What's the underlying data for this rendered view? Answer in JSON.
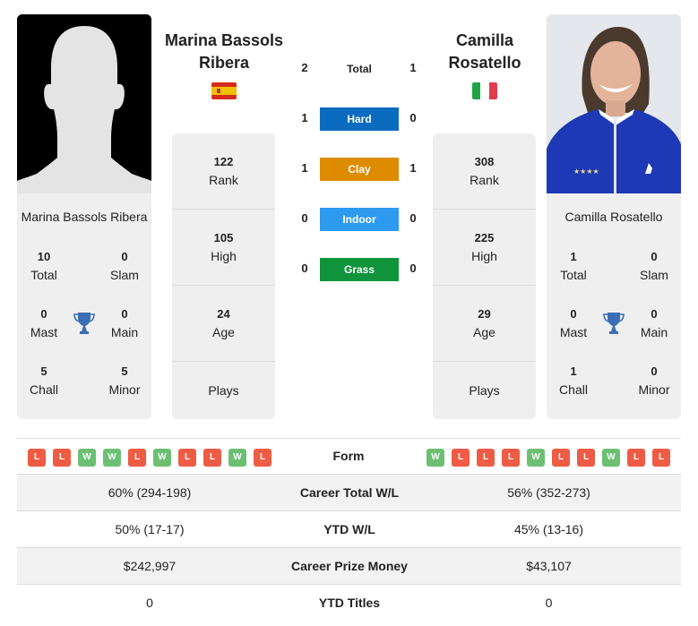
{
  "players": {
    "left": {
      "name": "Marina Bassols Ribera",
      "header_line1": "Marina Bassols",
      "header_line2": "Ribera",
      "flag": "spain-flag",
      "photo": "silhouette-placeholder",
      "rank": "122",
      "rank_label": "Rank",
      "high": "105",
      "high_label": "High",
      "age": "24",
      "age_label": "Age",
      "plays_label": "Plays",
      "titles": {
        "total": "10",
        "total_label": "Total",
        "slam": "0",
        "slam_label": "Slam",
        "mast": "0",
        "mast_label": "Mast",
        "main": "0",
        "main_label": "Main",
        "chall": "5",
        "chall_label": "Chall",
        "minor": "5",
        "minor_label": "Minor"
      },
      "form": [
        "L",
        "L",
        "W",
        "W",
        "L",
        "W",
        "L",
        "L",
        "W",
        "L"
      ]
    },
    "right": {
      "name": "Camilla Rosatello",
      "header_line1": "Camilla",
      "header_line2": "Rosatello",
      "flag": "italy-flag",
      "photo": "player-photo",
      "rank": "308",
      "rank_label": "Rank",
      "high": "225",
      "high_label": "High",
      "age": "29",
      "age_label": "Age",
      "plays_label": "Plays",
      "titles": {
        "total": "1",
        "total_label": "Total",
        "slam": "0",
        "slam_label": "Slam",
        "mast": "0",
        "mast_label": "Mast",
        "main": "0",
        "main_label": "Main",
        "chall": "1",
        "chall_label": "Chall",
        "minor": "0",
        "minor_label": "Minor"
      },
      "form": [
        "W",
        "L",
        "L",
        "L",
        "W",
        "L",
        "L",
        "W",
        "L",
        "L"
      ]
    }
  },
  "h2h": [
    {
      "label": "Total",
      "left": "2",
      "right": "1",
      "color": ""
    },
    {
      "label": "Hard",
      "left": "1",
      "right": "0",
      "color": "#0a6bbf"
    },
    {
      "label": "Clay",
      "left": "1",
      "right": "1",
      "color": "#dd8c00"
    },
    {
      "label": "Indoor",
      "left": "0",
      "right": "0",
      "color": "#2d9af0"
    },
    {
      "label": "Grass",
      "left": "0",
      "right": "0",
      "color": "#0f933b"
    }
  ],
  "form_label": "Form",
  "stats": [
    {
      "label": "Career Total W/L",
      "left": "60% (294-198)",
      "right": "56% (352-273)"
    },
    {
      "label": "YTD W/L",
      "left": "50% (17-17)",
      "right": "45% (13-16)"
    },
    {
      "label": "Career Prize Money",
      "left": "$242,997",
      "right": "$43,107"
    },
    {
      "label": "YTD Titles",
      "left": "0",
      "right": "0"
    }
  ],
  "colors": {
    "loss": "#ee5c45",
    "win": "#6cbf73",
    "trophy": "#3a6fb5",
    "card_bg": "#efefef"
  }
}
